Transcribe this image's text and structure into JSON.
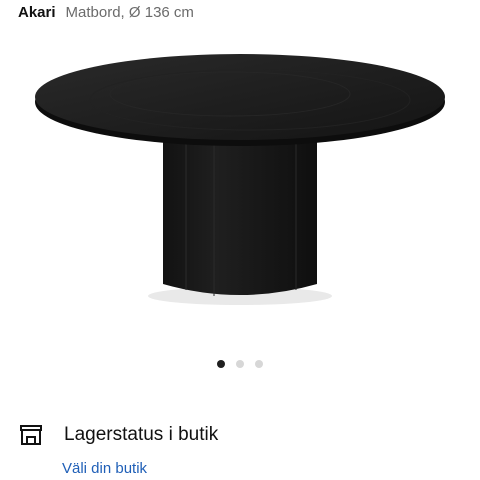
{
  "product": {
    "brand": "Akari",
    "description": "Matbord, Ø 136 cm",
    "image_alt": "black round dining table"
  },
  "carousel": {
    "count": 3,
    "active_index": 0
  },
  "stock": {
    "icon": "store-icon",
    "label": "Lagerstatus i butik",
    "link": "Väli din butik"
  },
  "colors": {
    "link": "#1f5fb7",
    "dot_active": "#1f1f1f",
    "dot_inactive": "#d7d7d7",
    "table": "#1b1b1b"
  }
}
